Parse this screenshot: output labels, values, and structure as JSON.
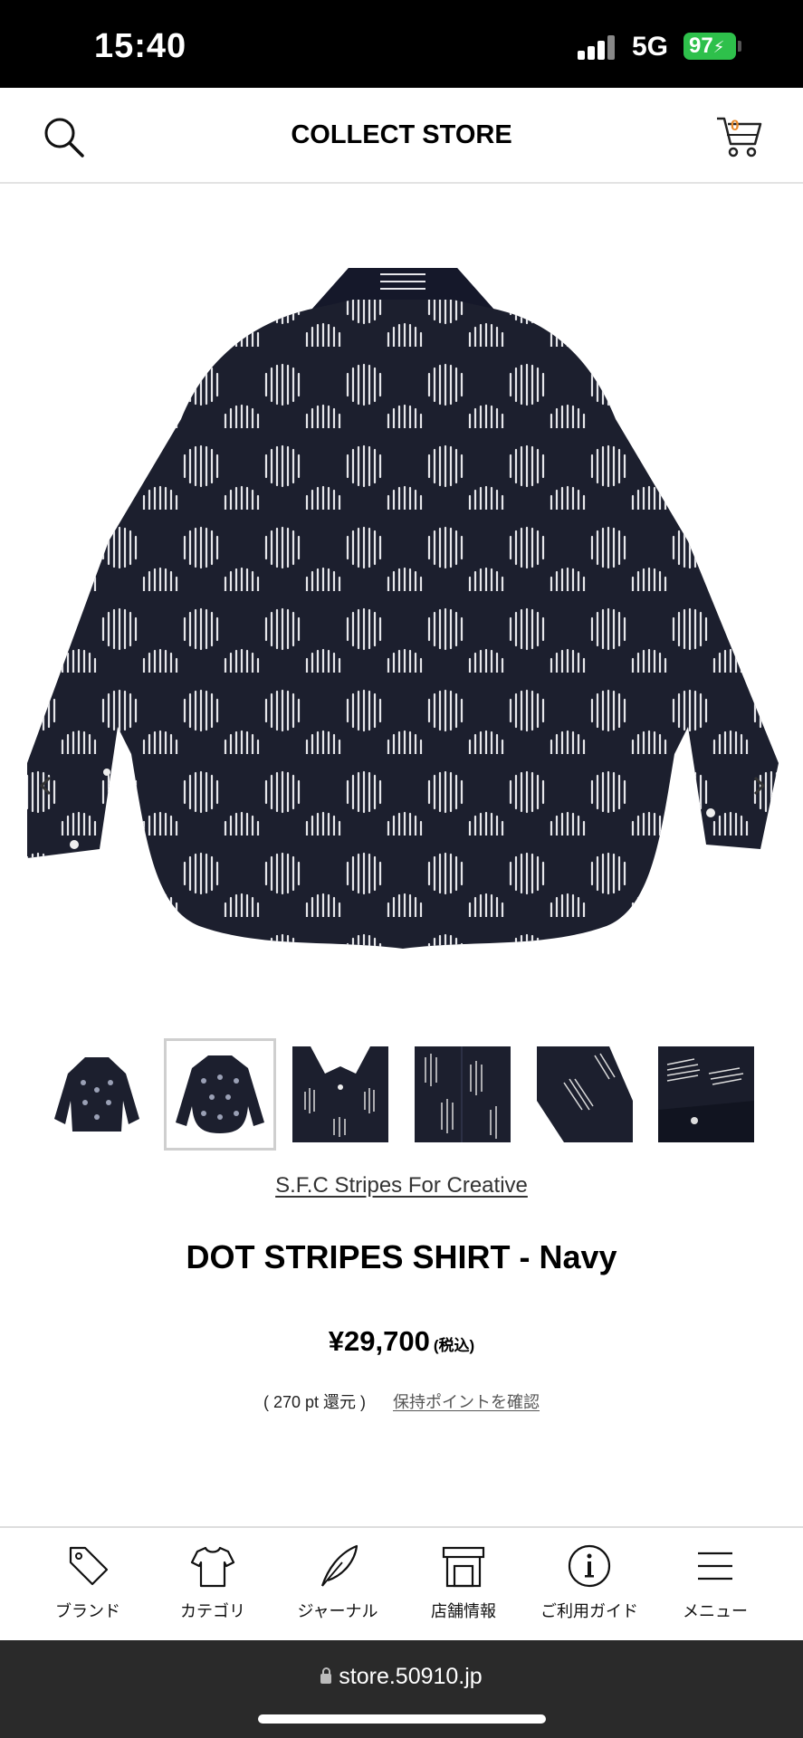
{
  "status_bar": {
    "time": "15:40",
    "network": "5G",
    "battery": "97"
  },
  "header": {
    "title": "COLLECT STORE",
    "cart_count": "0"
  },
  "product": {
    "brand": "S.F.C Stripes For Creative",
    "name": "DOT STRIPES SHIRT - Navy",
    "price": "¥29,700",
    "tax_note": "(税込)",
    "points": "( 270 pt 還元 )",
    "points_link": "保持ポイントを確認"
  },
  "gallery": {
    "thumbnail_count": 6,
    "active_index": 1
  },
  "bottom_nav": [
    {
      "label": "ブランド",
      "icon": "tag-icon"
    },
    {
      "label": "カテゴリ",
      "icon": "tshirt-icon"
    },
    {
      "label": "ジャーナル",
      "icon": "quill-icon"
    },
    {
      "label": "店舗情報",
      "icon": "store-icon"
    },
    {
      "label": "ご利用ガイド",
      "icon": "info-icon"
    },
    {
      "label": "メニュー",
      "icon": "menu-icon"
    }
  ],
  "browser": {
    "url": "store.50910.jp"
  },
  "colors": {
    "shirt_navy": "#1c1f2e",
    "battery_green": "#2ec04b",
    "cart_accent": "#e8892a"
  }
}
